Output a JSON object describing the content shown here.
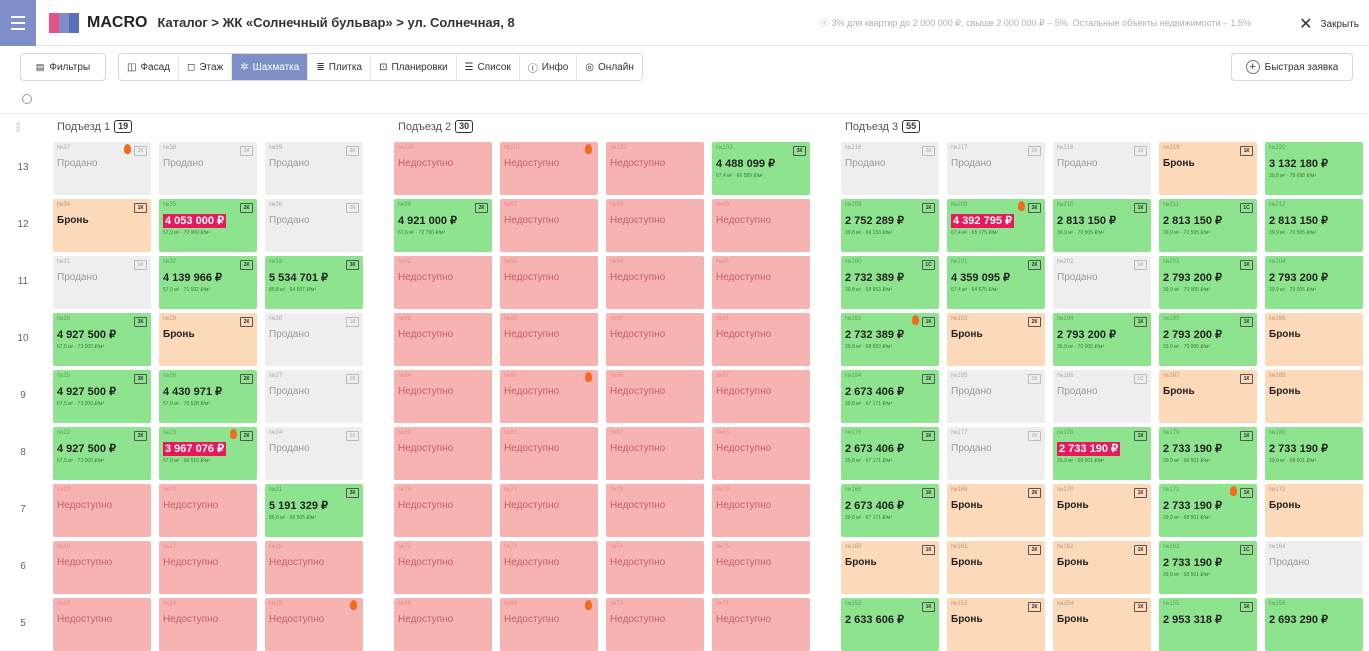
{
  "header": {
    "brand": "MACRO",
    "breadcrumb": "Каталог  >  ЖК «Солнечный бульвар»  >  ул. Солнечная, 8",
    "note": "ⓢ 3% для квартир до 2 000 000 ₽, свыше 2 000 000 ₽ – 5%. Остальные объекты недвижимости – 1,5%",
    "close_label": "Закрыть"
  },
  "toolbar": {
    "filters": "Фильтры",
    "tabs": [
      "Фасад",
      "Этаж",
      "Шахматка",
      "Плитка",
      "Планировки",
      "Список",
      "Инфо",
      "Онлайн"
    ],
    "active_tab": "Шахматка",
    "quick_request": "Быстрая заявка"
  },
  "floors": [
    "13",
    "12",
    "11",
    "10",
    "9",
    "8",
    "7",
    "6",
    "5"
  ],
  "sections": [
    {
      "name": "Подъезд 1",
      "count": "19"
    },
    {
      "name": "Подъезд 2",
      "count": "30"
    },
    {
      "name": "Подъезд 3",
      "count": "55"
    }
  ],
  "status_labels": {
    "sold": "Продано",
    "reserved": "Бронь",
    "na": "Недоступно"
  },
  "colors": {
    "sold": "#eeeeee",
    "reserved": "#fcd9b8",
    "unavailable": "#f7b2b2",
    "available": "#8ee48e",
    "accent": "#7e8fc8",
    "highlight": "#e8195a"
  },
  "grid": [
    [
      [
        {
          "n": "№37",
          "s": "sold",
          "r": "2К",
          "f": true
        },
        {
          "n": "№38",
          "s": "sold",
          "r": "2К"
        },
        {
          "n": "№39",
          "s": "sold",
          "r": "3К"
        }
      ],
      [
        {
          "n": "№100",
          "s": "na"
        },
        {
          "n": "№101",
          "s": "na",
          "f": true
        },
        {
          "n": "№102",
          "s": "na"
        },
        {
          "n": "№103",
          "s": "av",
          "r": "3К",
          "p": "4 488 099 ₽",
          "m": "67,4 м² · 66 589 ₽/м²"
        }
      ],
      [
        {
          "n": "№216",
          "s": "sold",
          "r": "1К"
        },
        {
          "n": "№217",
          "s": "sold",
          "r": "2К"
        },
        {
          "n": "№218",
          "s": "sold",
          "r": "1К"
        },
        {
          "n": "№219",
          "s": "res",
          "r": "1К"
        },
        {
          "n": "№220",
          "s": "av",
          "p": "3 132 180 ₽",
          "m": "39,8 м² · 78 698 ₽/м²"
        }
      ]
    ],
    [
      [
        {
          "n": "№34",
          "s": "res",
          "r": "1К"
        },
        {
          "n": "№35",
          "s": "av",
          "r": "2К",
          "p": "4 053 000 ₽",
          "hl": true,
          "m": "57,9 м² · 70 000 ₽/м²"
        },
        {
          "n": "№36",
          "s": "sold",
          "r": "3К"
        }
      ],
      [
        {
          "n": "№96",
          "s": "av",
          "r": "2К",
          "p": "4 921 000 ₽",
          "m": "67,6 м² · 72 796 ₽/м²"
        },
        {
          "n": "№97",
          "s": "na"
        },
        {
          "n": "№98",
          "s": "na"
        },
        {
          "n": "№99",
          "s": "na"
        }
      ],
      [
        {
          "n": "№208",
          "s": "av",
          "r": "1К",
          "p": "2 752 289 ₽",
          "m": "39,8 м² · 69 153 ₽/м²"
        },
        {
          "n": "№209",
          "s": "av",
          "r": "2К",
          "p": "4 392 795 ₽",
          "hl": true,
          "f": true,
          "m": "67,4 м² · 65 175 ₽/м²"
        },
        {
          "n": "№210",
          "s": "av",
          "r": "1К",
          "p": "2 813 150 ₽",
          "m": "39,9 м² · 70 505 ₽/м²"
        },
        {
          "n": "№211",
          "s": "av",
          "r": "1С",
          "p": "2 813 150 ₽",
          "m": "39,9 м² · 70 505 ₽/м²"
        },
        {
          "n": "№212",
          "s": "av",
          "p": "2 813 150 ₽",
          "m": "39,9 м² · 70 505 ₽/м²"
        }
      ]
    ],
    [
      [
        {
          "n": "№31",
          "s": "sold",
          "r": "1К"
        },
        {
          "n": "№32",
          "s": "av",
          "r": "2К",
          "p": "4 139 966 ₽",
          "m": "57,9 м² · 71 502 ₽/м²"
        },
        {
          "n": "№33",
          "s": "av",
          "r": "3К",
          "p": "5 534 701 ₽",
          "m": "85,8 м² · 64 507 ₽/м²"
        }
      ],
      [
        {
          "n": "№92",
          "s": "na"
        },
        {
          "n": "№93",
          "s": "na"
        },
        {
          "n": "№94",
          "s": "na"
        },
        {
          "n": "№95",
          "s": "na"
        }
      ],
      [
        {
          "n": "№200",
          "s": "av",
          "r": "1С",
          "p": "2 732 389 ₽",
          "m": "39,8 м² · 68 653 ₽/м²"
        },
        {
          "n": "№201",
          "s": "av",
          "r": "2К",
          "p": "4 359 095 ₽",
          "m": "67,4 м² · 64 675 ₽/м²"
        },
        {
          "n": "№202",
          "s": "sold",
          "r": "1К"
        },
        {
          "n": "№203",
          "s": "av",
          "r": "1К",
          "p": "2 793 200 ₽",
          "m": "39,9 м² · 70 005 ₽/м²"
        },
        {
          "n": "№204",
          "s": "av",
          "p": "2 793 200 ₽",
          "m": "39,9 м² · 70 005 ₽/м²"
        }
      ]
    ],
    [
      [
        {
          "n": "№28",
          "s": "av",
          "r": "3К",
          "p": "4 927 500 ₽",
          "m": "67,5 м² · 73 000 ₽/м²"
        },
        {
          "n": "№29",
          "s": "res",
          "r": "2К"
        },
        {
          "n": "№30",
          "s": "sold",
          "r": "1К"
        }
      ],
      [
        {
          "n": "№88",
          "s": "na"
        },
        {
          "n": "№89",
          "s": "na"
        },
        {
          "n": "№90",
          "s": "na"
        },
        {
          "n": "№91",
          "s": "na"
        }
      ],
      [
        {
          "n": "№192",
          "s": "av",
          "r": "1К",
          "f": true,
          "p": "2 732 389 ₽",
          "m": "39,8 м² · 68 653 ₽/м²"
        },
        {
          "n": "№193",
          "s": "res",
          "r": "2К"
        },
        {
          "n": "№194",
          "s": "av",
          "r": "1К",
          "p": "2 793 200 ₽",
          "m": "39,9 м² · 70 005 ₽/м²"
        },
        {
          "n": "№195",
          "s": "av",
          "r": "1К",
          "p": "2 793 200 ₽",
          "m": "39,9 м² · 70 005 ₽/м²"
        },
        {
          "n": "№196",
          "s": "res"
        }
      ]
    ],
    [
      [
        {
          "n": "№25",
          "s": "av",
          "r": "3К",
          "p": "4 927 500 ₽",
          "m": "67,5 м² · 73 000 ₽/м²"
        },
        {
          "n": "№26",
          "s": "av",
          "r": "2К",
          "p": "4 430 971 ₽",
          "m": "57,9 м² · 76 528 ₽/м²"
        },
        {
          "n": "№27",
          "s": "sold",
          "r": "1К"
        }
      ],
      [
        {
          "n": "№84",
          "s": "na"
        },
        {
          "n": "№85",
          "s": "na",
          "f": true
        },
        {
          "n": "№86",
          "s": "na"
        },
        {
          "n": "№87",
          "s": "na"
        }
      ],
      [
        {
          "n": "№184",
          "s": "av",
          "r": "1К",
          "p": "2 673 406 ₽",
          "m": "39,8 м² · 67 171 ₽/м²"
        },
        {
          "n": "№185",
          "s": "sold",
          "r": "2К"
        },
        {
          "n": "№186",
          "s": "sold",
          "r": "1С"
        },
        {
          "n": "№187",
          "s": "res",
          "r": "1К"
        },
        {
          "n": "№188",
          "s": "res"
        }
      ]
    ],
    [
      [
        {
          "n": "№22",
          "s": "av",
          "r": "2К",
          "p": "4 927 500 ₽",
          "m": "67,5 м² · 73 000 ₽/м²"
        },
        {
          "n": "№23",
          "s": "av",
          "r": "2К",
          "f": true,
          "p": "3 967 076 ₽",
          "hl": true,
          "m": "57,9 м² · 68 516 ₽/м²"
        },
        {
          "n": "№24",
          "s": "sold",
          "r": "1К"
        }
      ],
      [
        {
          "n": "№80",
          "s": "na"
        },
        {
          "n": "№81",
          "s": "na"
        },
        {
          "n": "№82",
          "s": "na"
        },
        {
          "n": "№83",
          "s": "na"
        }
      ],
      [
        {
          "n": "№176",
          "s": "av",
          "r": "1К",
          "p": "2 673 406 ₽",
          "m": "39,8 м² · 67 171 ₽/м²"
        },
        {
          "n": "№177",
          "s": "sold",
          "r": "2К"
        },
        {
          "n": "№178",
          "s": "av",
          "r": "1К",
          "p": "2 733 190 ₽",
          "hl": true,
          "m": "39,9 м² · 68 501 ₽/м²"
        },
        {
          "n": "№179",
          "s": "av",
          "r": "1К",
          "p": "2 733 190 ₽",
          "m": "39,9 м² · 68 501 ₽/м²"
        },
        {
          "n": "№180",
          "s": "av",
          "p": "2 733 190 ₽",
          "m": "39,9 м² · 68 501 ₽/м²"
        }
      ]
    ],
    [
      [
        {
          "n": "№19",
          "s": "na"
        },
        {
          "n": "№20",
          "s": "na"
        },
        {
          "n": "№21",
          "s": "av",
          "r": "3К",
          "p": "5 191 329 ₽",
          "m": "85,8 м² · 60 505 ₽/м²"
        }
      ],
      [
        {
          "n": "№76",
          "s": "na"
        },
        {
          "n": "№77",
          "s": "na"
        },
        {
          "n": "№78",
          "s": "na"
        },
        {
          "n": "№79",
          "s": "na"
        }
      ],
      [
        {
          "n": "№168",
          "s": "av",
          "r": "1К",
          "p": "2 673 406 ₽",
          "m": "39,8 м² · 67 171 ₽/м²"
        },
        {
          "n": "№169",
          "s": "res",
          "r": "2К"
        },
        {
          "n": "№170",
          "s": "res",
          "r": "1К"
        },
        {
          "n": "№171",
          "s": "av",
          "r": "1К",
          "f": true,
          "p": "2 733 190 ₽",
          "m": "39,9 м² · 68 501 ₽/м²"
        },
        {
          "n": "№172",
          "s": "res"
        }
      ]
    ],
    [
      [
        {
          "n": "№16",
          "s": "na"
        },
        {
          "n": "№17",
          "s": "na"
        },
        {
          "n": "№18",
          "s": "na"
        }
      ],
      [
        {
          "n": "№72",
          "s": "na"
        },
        {
          "n": "№73",
          "s": "na"
        },
        {
          "n": "№74",
          "s": "na"
        },
        {
          "n": "№75",
          "s": "na"
        }
      ],
      [
        {
          "n": "№160",
          "s": "res",
          "r": "1К"
        },
        {
          "n": "№161",
          "s": "res",
          "r": "2К"
        },
        {
          "n": "№162",
          "s": "res",
          "r": "1К"
        },
        {
          "n": "№163",
          "s": "av",
          "r": "1С",
          "p": "2 733 190 ₽",
          "m": "39,9 м² · 68 501 ₽/м²"
        },
        {
          "n": "№164",
          "s": "sold"
        }
      ]
    ],
    [
      [
        {
          "n": "№13",
          "s": "na"
        },
        {
          "n": "№14",
          "s": "na"
        },
        {
          "n": "№15",
          "s": "na",
          "f": true
        }
      ],
      [
        {
          "n": "№68",
          "s": "na"
        },
        {
          "n": "№69",
          "s": "na",
          "f": true
        },
        {
          "n": "№70",
          "s": "na"
        },
        {
          "n": "№71",
          "s": "na"
        }
      ],
      [
        {
          "n": "№152",
          "s": "av",
          "r": "1К",
          "p": "2 633 606 ₽"
        },
        {
          "n": "№153",
          "s": "res",
          "r": "2К"
        },
        {
          "n": "№154",
          "s": "res",
          "r": "1К"
        },
        {
          "n": "№155",
          "s": "av",
          "r": "1К",
          "p": "2 953 318 ₽"
        },
        {
          "n": "№156",
          "s": "av",
          "p": "2 693 290 ₽"
        }
      ]
    ]
  ]
}
